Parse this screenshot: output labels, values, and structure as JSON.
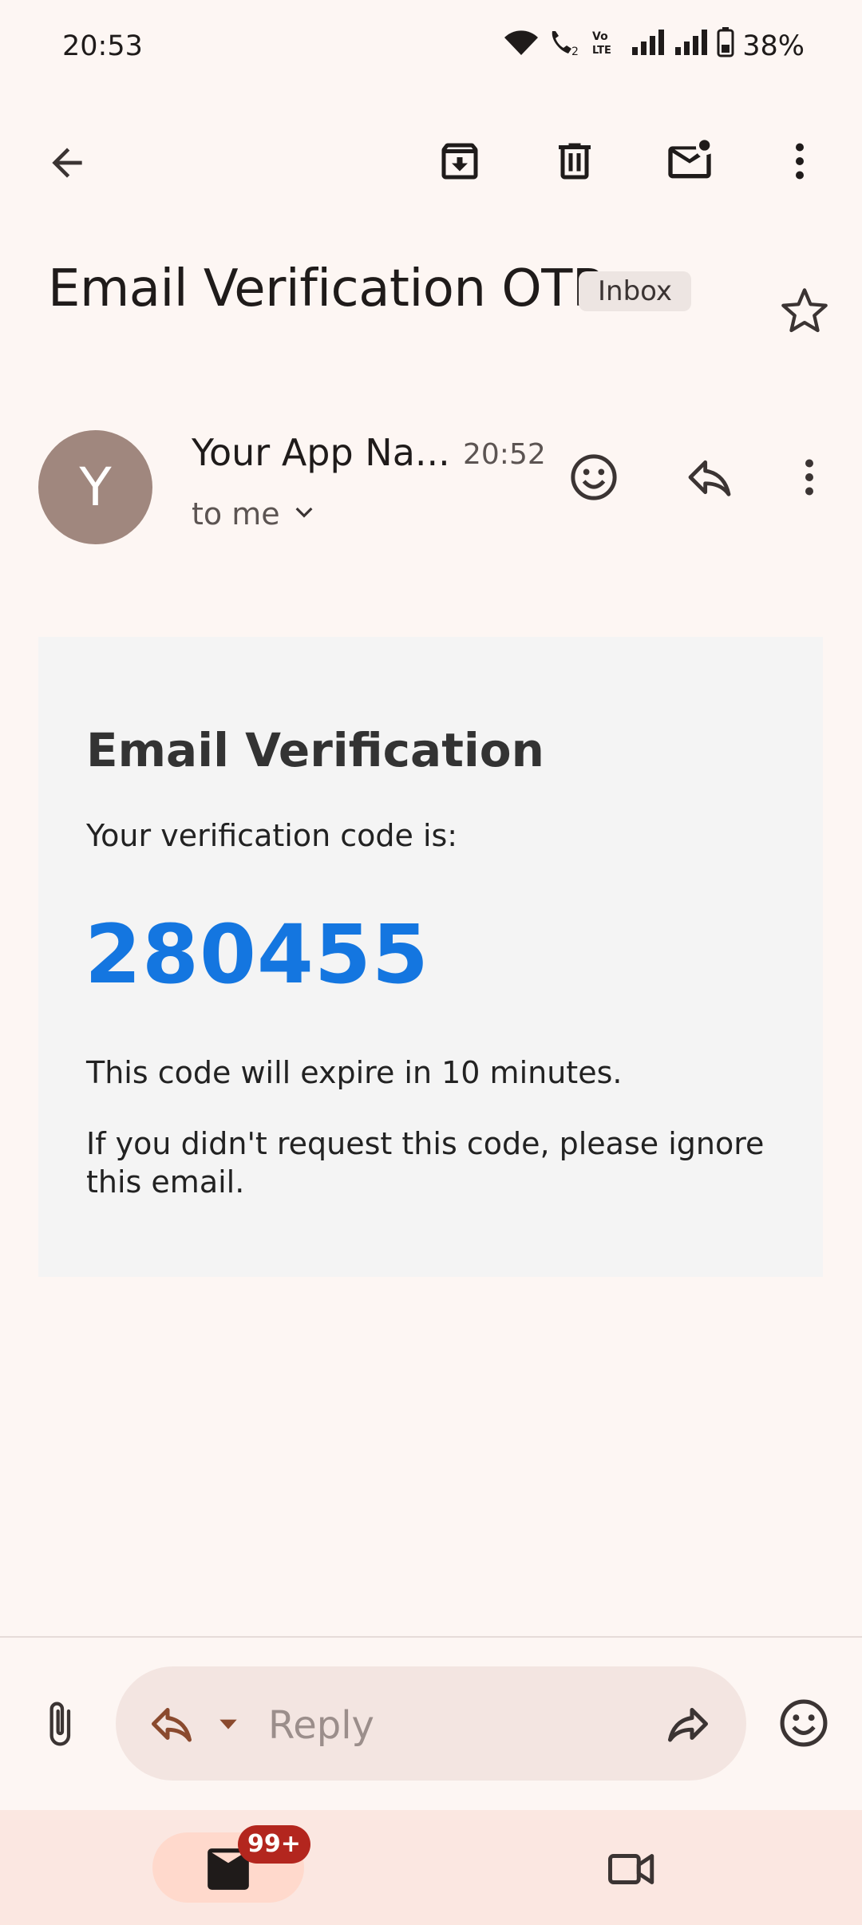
{
  "status_bar": {
    "time": "20:53",
    "battery": "38%"
  },
  "toolbar": {
    "icons": [
      "back-arrow-icon",
      "archive-icon",
      "delete-icon",
      "mark-unread-icon",
      "more-vert-icon"
    ]
  },
  "email": {
    "subject": "Email Verification OTP",
    "label": "Inbox",
    "sender_initial": "Y",
    "sender_name": "Your App Na...",
    "time": "20:52",
    "recipient": "to me",
    "body": {
      "heading": "Email Verification",
      "intro": "Your verification code is:",
      "code": "280455",
      "expiry": "This code will expire in 10 minutes.",
      "ignore_note": "If you didn't request this code, please ignore this email."
    }
  },
  "reply_bar": {
    "placeholder": "Reply"
  },
  "bottom_nav": {
    "mail_badge": "99+"
  },
  "colors": {
    "background": "#fdf6f3",
    "code": "#1476e0",
    "avatar": "#a0877e",
    "badge": "#b3261e"
  }
}
